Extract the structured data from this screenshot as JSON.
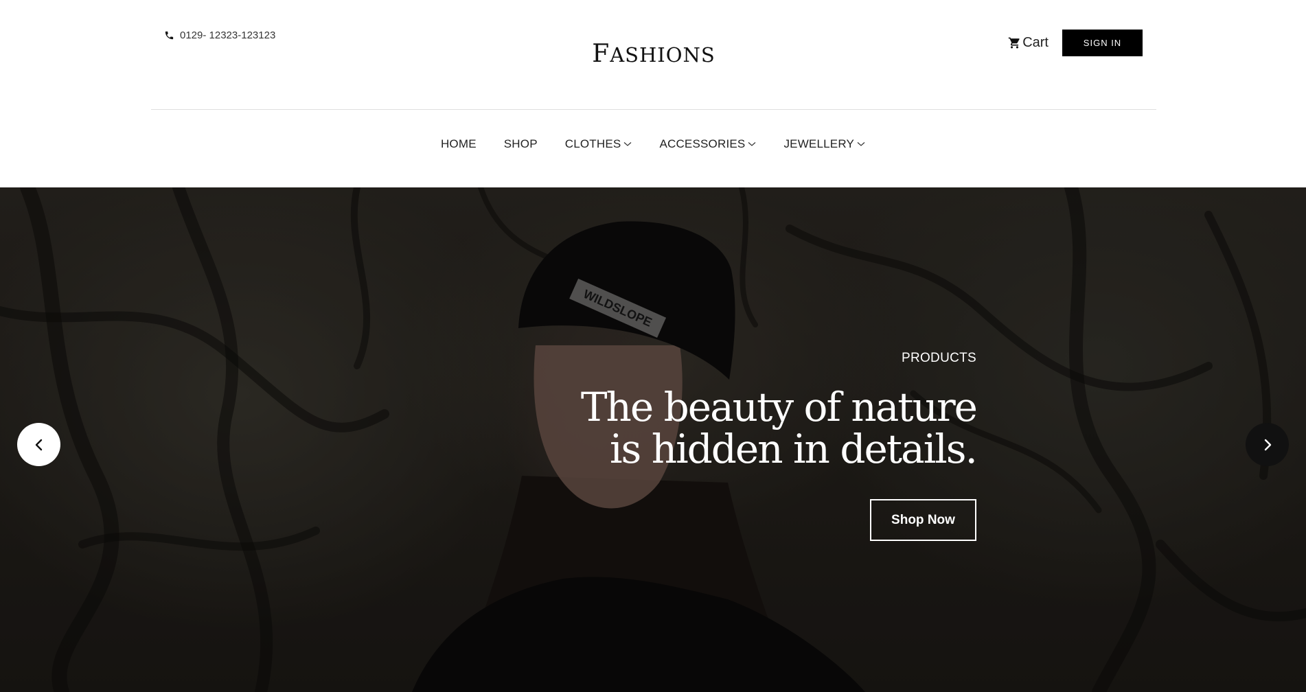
{
  "header": {
    "phone": "0129- 12323-123123",
    "phone_icon": "phone-icon",
    "logo": {
      "first_letter": "F",
      "rest": "ASHIONS"
    },
    "cart_label": "Cart",
    "cart_icon": "cart-icon",
    "signin_label": "SIGN IN"
  },
  "nav": {
    "items": [
      {
        "label": "HOME",
        "dropdown": false
      },
      {
        "label": "SHOP",
        "dropdown": false
      },
      {
        "label": "CLOTHES",
        "dropdown": true
      },
      {
        "label": "ACCESSORIES",
        "dropdown": true
      },
      {
        "label": "JEWELLERY",
        "dropdown": true
      }
    ]
  },
  "hero": {
    "eyebrow": "PRODUCTS",
    "title_line1": "The beauty of nature",
    "title_line2": "is hidden in details.",
    "button_label": "Shop Now",
    "image_text_hat": "WILDSLOPE"
  },
  "colors": {
    "primary": "#000000",
    "hero_overlay": "#1f1b18",
    "text": "#222222"
  }
}
